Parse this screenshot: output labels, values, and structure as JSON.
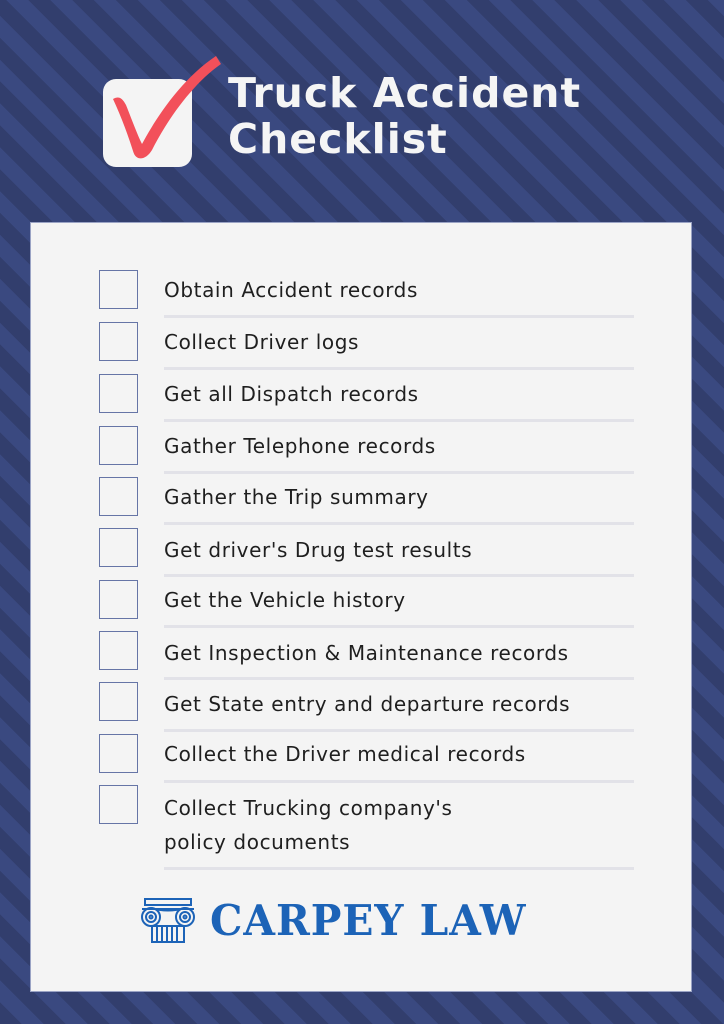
{
  "header": {
    "title_line1": "Truck Accident",
    "title_line2": "Checklist",
    "logo_icon": "checkmark-box-icon",
    "check_color": "#f2505a"
  },
  "checklist": {
    "items": [
      {
        "label": "Obtain Accident records",
        "checked": false
      },
      {
        "label": "Collect Driver logs",
        "checked": false
      },
      {
        "label": "Get all Dispatch records",
        "checked": false
      },
      {
        "label": "Gather Telephone records",
        "checked": false
      },
      {
        "label": "Gather the Trip summary",
        "checked": false
      },
      {
        "label": "Get driver's Drug test results",
        "checked": false
      },
      {
        "label": "Get the Vehicle history",
        "checked": false
      },
      {
        "label": "Get Inspection & Maintenance records",
        "checked": false
      },
      {
        "label": "Get State entry and departure records",
        "checked": false
      },
      {
        "label": "Collect the Driver medical records",
        "checked": false
      },
      {
        "label_line1": "Collect Trucking company's",
        "label_line2": "policy documents",
        "checked": false
      }
    ]
  },
  "footer": {
    "brand_name": "CARPEY LAW",
    "brand_icon": "ionic-column-icon",
    "brand_color": "#1c63b7"
  },
  "colors": {
    "background_dark": "#323e6d",
    "background_light": "#3a4980",
    "card": "#f4f4f4",
    "checkbox_border": "#6675a6",
    "divider": "#e2e2e8"
  }
}
